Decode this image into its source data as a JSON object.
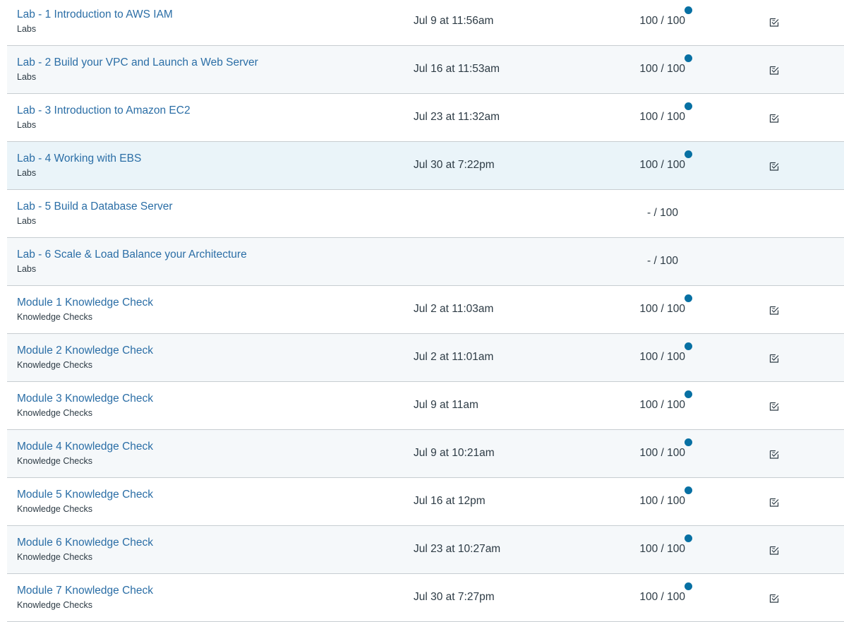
{
  "colors": {
    "link": "#2b6ea6",
    "text": "#2d3b45",
    "unread_dot": "#0770a3",
    "row_alt": "#f5f8fa",
    "row_highlight": "#eaf4f9",
    "divider": "#c7cdd1"
  },
  "rows": [
    {
      "title": "Lab - 1 Introduction to AWS IAM",
      "category": "Labs",
      "submitted": "Jul 9 at 11:56am",
      "score": "100 / 100",
      "unread": true,
      "has_icon": true,
      "icon": "rubric-icon"
    },
    {
      "title": "Lab - 2 Build your VPC and Launch a Web Server",
      "category": "Labs",
      "submitted": "Jul 16 at 11:53am",
      "score": "100 / 100",
      "unread": true,
      "has_icon": true,
      "icon": "rubric-icon"
    },
    {
      "title": "Lab - 3 Introduction to Amazon EC2",
      "category": "Labs",
      "submitted": "Jul 23 at 11:32am",
      "score": "100 / 100",
      "unread": true,
      "has_icon": true,
      "icon": "rubric-icon"
    },
    {
      "title": "Lab - 4 Working with EBS",
      "category": "Labs",
      "submitted": "Jul 30 at 7:22pm",
      "score": "100 / 100",
      "unread": true,
      "has_icon": true,
      "icon": "rubric-icon"
    },
    {
      "title": "Lab - 5 Build a Database Server",
      "category": "Labs",
      "submitted": "",
      "score": "- / 100",
      "unread": false,
      "has_icon": false
    },
    {
      "title": "Lab - 6 Scale & Load Balance your Architecture",
      "category": "Labs",
      "submitted": "",
      "score": "- / 100",
      "unread": false,
      "has_icon": false
    },
    {
      "title": "Module 1 Knowledge Check",
      "category": "Knowledge Checks",
      "submitted": "Jul 2 at 11:03am",
      "score": "100 / 100",
      "unread": true,
      "has_icon": true,
      "icon": "rubric-icon"
    },
    {
      "title": "Module 2 Knowledge Check",
      "category": "Knowledge Checks",
      "submitted": "Jul 2 at 11:01am",
      "score": "100 / 100",
      "unread": true,
      "has_icon": true,
      "icon": "rubric-icon"
    },
    {
      "title": "Module 3 Knowledge Check",
      "category": "Knowledge Checks",
      "submitted": "Jul 9 at 11am",
      "score": "100 / 100",
      "unread": true,
      "has_icon": true,
      "icon": "rubric-icon"
    },
    {
      "title": "Module 4 Knowledge Check",
      "category": "Knowledge Checks",
      "submitted": "Jul 9 at 10:21am",
      "score": "100 / 100",
      "unread": true,
      "has_icon": true,
      "icon": "rubric-icon"
    },
    {
      "title": "Module 5 Knowledge Check",
      "category": "Knowledge Checks",
      "submitted": "Jul 16 at 12pm",
      "score": "100 / 100",
      "unread": true,
      "has_icon": true,
      "icon": "rubric-icon"
    },
    {
      "title": "Module 6 Knowledge Check",
      "category": "Knowledge Checks",
      "submitted": "Jul 23 at 10:27am",
      "score": "100 / 100",
      "unread": true,
      "has_icon": true,
      "icon": "rubric-icon"
    },
    {
      "title": "Module 7 Knowledge Check",
      "category": "Knowledge Checks",
      "submitted": "Jul 30 at 7:27pm",
      "score": "100 / 100",
      "unread": true,
      "has_icon": true,
      "icon": "rubric-icon"
    }
  ]
}
